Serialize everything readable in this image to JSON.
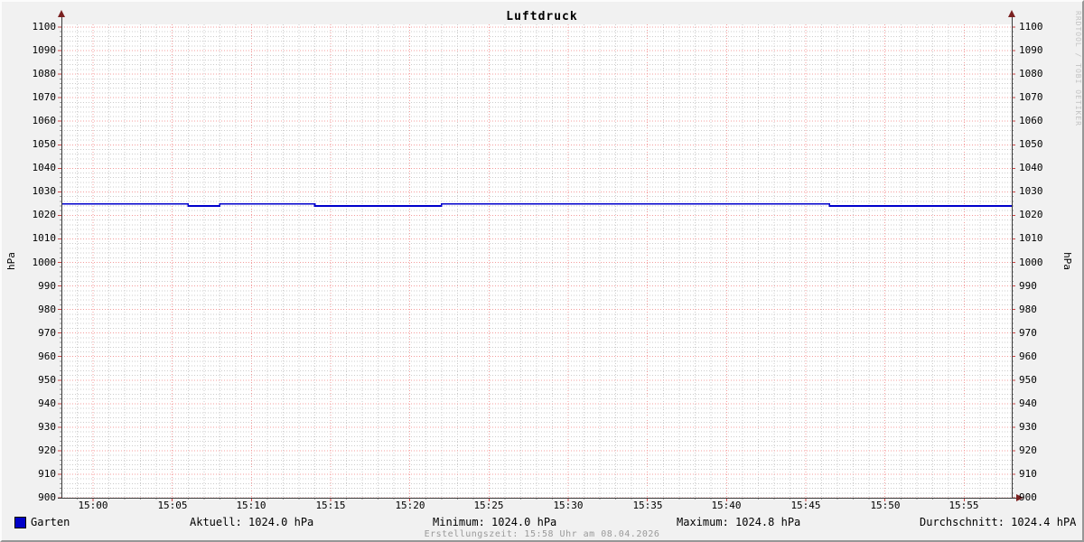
{
  "chart": {
    "title": "Luftdruck",
    "y_axis_unit": "hPa",
    "watermark": "RRDTOOL / TOBI OETIKER",
    "footer": "Erstellungszeit: 15:58 Uhr am 08.04.2026",
    "legend": {
      "series_label": "Garten",
      "stats": [
        {
          "id": "aktuell",
          "text": "Aktuell: 1024.0 hPa"
        },
        {
          "id": "minimum",
          "text": "Minimum: 1024.0 hPa"
        },
        {
          "id": "maximum",
          "text": "Maximum: 1024.8 hPa"
        },
        {
          "id": "durchschnitt",
          "text": "Durchschnitt: 1024.4 hPA"
        }
      ]
    }
  },
  "chart_data": {
    "type": "line",
    "title": "Luftdruck",
    "xlabel": "",
    "ylabel": "hPa",
    "ylim": [
      900,
      1100
    ],
    "y_major_step": 10,
    "y_minor_step": 2,
    "y_tick_labels": [
      "900",
      "910",
      "920",
      "930",
      "940",
      "950",
      "960",
      "970",
      "980",
      "990",
      "1000",
      "1010",
      "1020",
      "1030",
      "1040",
      "1050",
      "1060",
      "1070",
      "1080",
      "1090",
      "1100"
    ],
    "x_range": [
      "14:58",
      "15:58"
    ],
    "x_total_minutes": 60,
    "x_first_label_minute": 2,
    "x_major_step_min": 5,
    "x_minor_step_min": 1,
    "x_tick_labels": [
      "15:00",
      "15:05",
      "15:10",
      "15:15",
      "15:20",
      "15:25",
      "15:30",
      "15:35",
      "15:40",
      "15:45",
      "15:50",
      "15:55"
    ],
    "series": [
      {
        "name": "Garten",
        "color": "#0000cc",
        "step_x_minutes": [
          0,
          8,
          10,
          16,
          24,
          48.5,
          60
        ],
        "values": [
          1024.8,
          1024.0,
          1024.8,
          1024.0,
          1024.8,
          1024.0,
          1024.0
        ]
      }
    ],
    "stats": {
      "aktuell_hpa": 1024.0,
      "minimum_hpa": 1024.0,
      "maximum_hpa": 1024.8,
      "durchschnitt_hpa": 1024.4
    },
    "grid": true,
    "legend_position": "bottom",
    "colors": {
      "series": "#0000cc",
      "legend_swatch": "#0000c8",
      "major_grid": "#f49c9c",
      "minor_grid": "#cccccc",
      "major_tick": "#cc4444",
      "minor_tick": "#9a9a9a",
      "axis": "#3a3a3a",
      "arrow": "#7a2020",
      "canvas": "#ffffff",
      "background": "#f1f1f1"
    }
  }
}
